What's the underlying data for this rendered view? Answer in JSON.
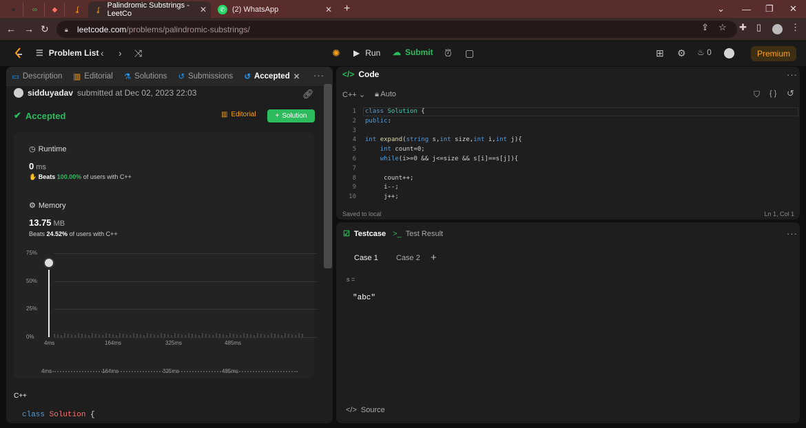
{
  "browser": {
    "tabs": [
      {
        "title": "Palindromic Substrings - LeetCo",
        "active": true
      },
      {
        "title": "(2) WhatsApp",
        "active": false
      }
    ],
    "address": {
      "host": "leetcode.com",
      "path": "/problems/palindromic-substrings/"
    }
  },
  "header": {
    "problem_list": "Problem List",
    "run": "Run",
    "submit": "Submit",
    "fire_count": "0",
    "premium": "Premium"
  },
  "left": {
    "tabs": [
      "Description",
      "Editorial",
      "Solutions",
      "Submissions",
      "Accepted"
    ],
    "submission": {
      "user": "sidduyadav",
      "text": "submitted at Dec 02, 2023 22:03"
    },
    "status": "Accepted",
    "editorial_btn": "Editorial",
    "solution_btn": "Solution",
    "runtime": {
      "title": "Runtime",
      "value": "0",
      "unit": "ms",
      "beats_pre": "Beats",
      "beats_pct": "100.00%",
      "beats_post": "of users with C++"
    },
    "memory": {
      "title": "Memory",
      "value": "13.75",
      "unit": "MB",
      "beats_pre": "Beats",
      "beats_pct": "24.52%",
      "beats_post": "of users with C++"
    },
    "language": "C++",
    "code_first_line": {
      "kw": "class",
      "name": "Solution",
      "brace": "{"
    }
  },
  "chart_data": {
    "type": "bar",
    "yticks": [
      "75%",
      "50%",
      "25%",
      "0%"
    ],
    "xticks": [
      "4ms",
      "164ms",
      "325ms",
      "485ms"
    ],
    "highlight": {
      "x": "4ms",
      "value": 0.6
    }
  },
  "code": {
    "title": "Code",
    "language": "C++",
    "mode": "Auto",
    "lines": [
      "class Solution {",
      "public:",
      "",
      "int expand(string s,int size,int i,int j){",
      "    int count=0;",
      "    while(i>=0 && j<=size && s[i]==s[j]){",
      "",
      "     count++;",
      "     i--;",
      "     j++;"
    ],
    "line_numbers": [
      "1",
      "2",
      "3",
      "4",
      "5",
      "6",
      "7",
      "8",
      "9",
      "10"
    ],
    "saved": "Saved to local",
    "position": "Ln 1, Col 1"
  },
  "testcase": {
    "tab": "Testcase",
    "result_tab": "Test Result",
    "cases": [
      "Case 1",
      "Case 2"
    ],
    "var_label": "s =",
    "var_value": "\"abc\"",
    "source": "Source"
  }
}
